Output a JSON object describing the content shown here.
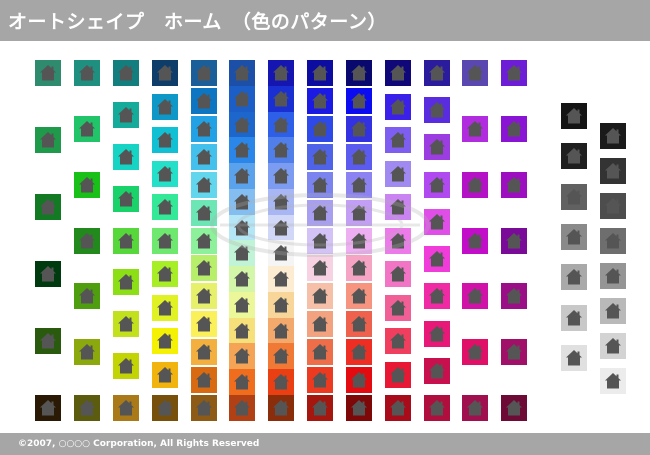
{
  "header": {
    "title": "オートシェイプ　ホーム　（色のパターン）"
  },
  "footer": {
    "copyright": "©2007, ○○○○ Corporation, All Rights Reserved"
  },
  "icon": {
    "name": "house-icon",
    "color": "#555555"
  },
  "palette": {
    "columns": [
      [
        "#2e8b6e",
        "#1e9a4a",
        "#117a22",
        "#003a0f",
        "#2a5a0e",
        "#2a1a05"
      ],
      [
        "#1f8f80",
        "#22c46a",
        "#18c018",
        "#22891d",
        "#4f9e10",
        "#8ba80d",
        "#5c5c0e"
      ],
      [
        "#127e7e",
        "#15ab9a",
        "#15d4c4",
        "#19d36a",
        "#57d83a",
        "#8cdf15",
        "#c2e11c",
        "#c3d405",
        "#a97a17"
      ],
      [
        "#0f3d6a",
        "#0d98c7",
        "#12c0d4",
        "#24e0c8",
        "#33e896",
        "#6fe870",
        "#a8ee27",
        "#e0f224",
        "#f5f105",
        "#f1b30d",
        "#77510b"
      ],
      [
        "#1a5f9a",
        "#0d76c2",
        "#22a2e4",
        "#43c1ec",
        "#61d6ec",
        "#6de6b6",
        "#8df09a",
        "#b7ef6b",
        "#e7f06a",
        "#faf05a",
        "#f3b03e",
        "#d86a12",
        "#8d5b15"
      ],
      [
        "#1c4fa8",
        "#1c5ec8",
        "#1c66cc",
        "#2a86e8",
        "#5aa2ec",
        "#84bdf0",
        "#b5e6f6",
        "#c1f3d6",
        "#d3f6a8",
        "#ecf79a",
        "#f6e07a",
        "#f5a355",
        "#f16d1e",
        "#b14115"
      ],
      [
        "#1515b2",
        "#1a2fd2",
        "#2e5fe8",
        "#507fea",
        "#7c9cf2",
        "#a8b7f3",
        "#d1d7f7",
        "#f5f5f5",
        "#fcecd2",
        "#f8d69a",
        "#f2a96b",
        "#f07a35",
        "#ea3e13",
        "#8a2d0b"
      ],
      [
        "#0c0ca0",
        "#1a1ae2",
        "#2d49e8",
        "#4e63e8",
        "#7a83ee",
        "#a89ff1",
        "#d3c2f5",
        "#f6d2e2",
        "#f6c0a8",
        "#f3a27f",
        "#ef6e4a",
        "#ec3a20",
        "#a4160e"
      ],
      [
        "#08086e",
        "#0c0cf0",
        "#3232e0",
        "#5b5bf0",
        "#8c82f2",
        "#c29ef4",
        "#eeaef2",
        "#f6a4c4",
        "#f69480",
        "#f0614d",
        "#ee2e22",
        "#e40b10",
        "#7e0707"
      ],
      [
        "#100878",
        "#3a20e8",
        "#7e5ef0",
        "#a08af2",
        "#ca84f2",
        "#ec7ae8",
        "#f274c5",
        "#f06096",
        "#f03e5e",
        "#e81834",
        "#a80b1a"
      ],
      [
        "#2b1c9e",
        "#5a2ce0",
        "#9b3de0",
        "#b04af0",
        "#e04ee8",
        "#f03cd8",
        "#f02aa4",
        "#e81878",
        "#c8104e",
        "#b00e3c"
      ],
      [
        "#5a48b0",
        "#b02cde",
        "#b512c8",
        "#c20ec8",
        "#d012a8",
        "#e01068",
        "#a0104e"
      ],
      [
        "#6e1dd6",
        "#8a14d4",
        "#9d0ec0",
        "#7a0a98",
        "#9b0f86",
        "#a01068",
        "#6e0a36"
      ],
      [
        "#141414",
        "#1f1f1f",
        "#616161",
        "#8a8a8a",
        "#a9a9a9",
        "#c8c8c8",
        "#e0e0e0"
      ],
      [
        "#1a1a1a",
        "#333333",
        "#4d4d4d",
        "#6e6e6e",
        "#959595",
        "#b9b9b9",
        "#d3d3d3",
        "#ececec"
      ]
    ]
  }
}
